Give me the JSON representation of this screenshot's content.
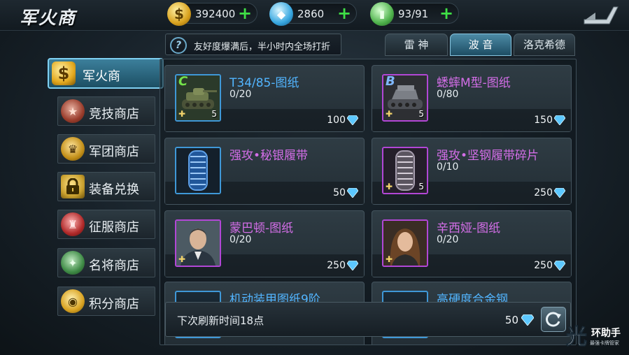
{
  "header": {
    "title": "军火商"
  },
  "resources": [
    {
      "icon": "dollar-coin-icon",
      "symbol": "$",
      "value": "392400"
    },
    {
      "icon": "diamond-icon",
      "symbol": "◆",
      "value": "2860"
    },
    {
      "icon": "battery-icon",
      "symbol": "▮",
      "value": "93/91"
    }
  ],
  "notice": {
    "text": "友好度爆满后，半小时内全场打折"
  },
  "tabs": [
    {
      "label": "雷 神",
      "active": false
    },
    {
      "label": "波 音",
      "active": true
    },
    {
      "label": "洛克希德",
      "active": false
    }
  ],
  "sidebar": {
    "items": [
      {
        "label": "军火商",
        "icon": "dollar-icon",
        "symbol": "$",
        "active": true
      },
      {
        "label": "竞技商店",
        "icon": "medal-icon",
        "symbol": "★"
      },
      {
        "label": "军团商店",
        "icon": "trophy-icon",
        "symbol": "♛"
      },
      {
        "label": "装备兑换",
        "icon": "lock-icon",
        "symbol": "🔒"
      },
      {
        "label": "征服商店",
        "icon": "shield-icon",
        "symbol": "♜"
      },
      {
        "label": "名将商店",
        "icon": "eagle-emblem-icon",
        "symbol": "✦"
      },
      {
        "label": "积分商店",
        "icon": "points-coin-icon",
        "symbol": "◉"
      }
    ]
  },
  "cards": [
    {
      "name": "T34/85-图纸",
      "progress": "0/20",
      "price": "100",
      "grade": "C",
      "count": "5",
      "image": "tank-icon",
      "name_color": "blue",
      "frame": "blue"
    },
    {
      "name": "蟋蟀M型-图纸",
      "progress": "0/80",
      "price": "150",
      "grade": "B",
      "count": "5",
      "image": "tank-destroyer-icon",
      "name_color": "purple",
      "frame": "purple"
    },
    {
      "name": "强攻•秘银履带",
      "progress": "",
      "price": "50",
      "grade": "",
      "count": "",
      "image": "track-icon",
      "name_color": "purple",
      "frame": "blue"
    },
    {
      "name": "强攻•坚钢履带碎片",
      "progress": "0/10",
      "price": "250",
      "grade": "",
      "count": "5",
      "image": "track-fragment-icon",
      "name_color": "purple",
      "frame": "purple"
    },
    {
      "name": "蒙巴顿-图纸",
      "progress": "0/20",
      "price": "250",
      "grade": "",
      "count": "",
      "image": "general-portrait-icon",
      "name_color": "purple",
      "frame": "purple"
    },
    {
      "name": "辛西娅-图纸",
      "progress": "0/20",
      "price": "250",
      "grade": "",
      "count": "",
      "image": "woman-portrait-icon",
      "name_color": "purple",
      "frame": "purple"
    },
    {
      "name": "机动装甲图纸9阶",
      "progress": "",
      "price": "",
      "grade": "",
      "count": "",
      "image": "armor-icon",
      "name_color": "blue",
      "frame": "blue"
    },
    {
      "name": "高硬度合金钢",
      "progress": "",
      "price": "",
      "grade": "",
      "count": "",
      "image": "steel-icon",
      "name_color": "blue",
      "frame": "blue"
    }
  ],
  "footer": {
    "text": "下次刷新时间18点",
    "price": "50"
  },
  "watermark": {
    "text": "环助手",
    "sub": "最强卡牌管家",
    "logo": "光"
  },
  "colors": {
    "accent": "#52b5ff",
    "purple": "#d46ee8",
    "plus": "#3fe046"
  }
}
